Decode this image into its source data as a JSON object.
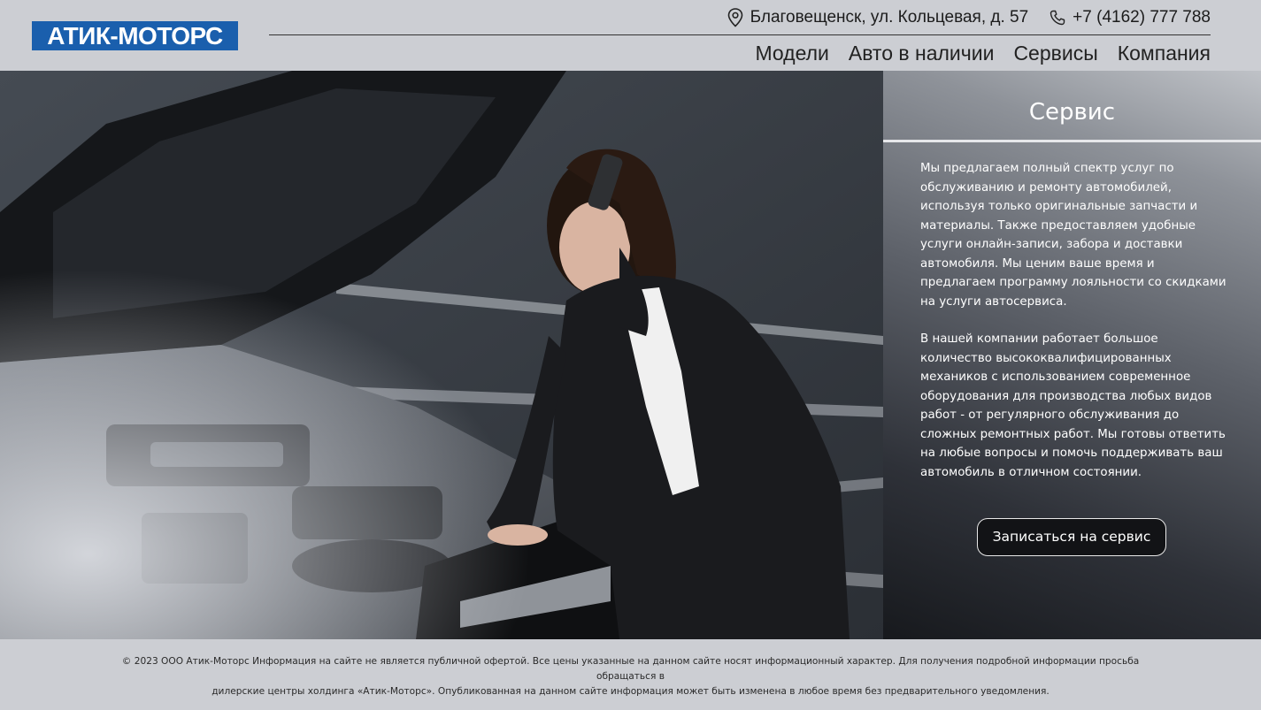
{
  "header": {
    "logo_text": "АТИК-МОТОРС",
    "address": "Благовещенск, ул. Кольцевая, д. 57",
    "phone": "+7 (4162) 777 788",
    "nav": [
      {
        "label": "Модели"
      },
      {
        "label": "Авто в наличии"
      },
      {
        "label": "Сервисы"
      },
      {
        "label": "Компания"
      }
    ]
  },
  "hero": {
    "image_alt": "Woman on phone looking under an open car hood",
    "panel": {
      "title": "Сервис",
      "paragraphs": [
        "Мы предлагаем полный спектр услуг по обслуживанию и ремонту автомобилей, используя только оригинальные запчасти и материалы. Также предоставляем удобные услуги онлайн-записи, забора и доставки автомобиля. Мы ценим ваше время и предлагаем программу лояльности со скидками на услуги автосервиса.",
        "В нашей компании работает большое количество высококвалифицированных механиков с использованием современное оборудования для производства любых видов работ - от регулярного обслуживания до сложных ремонтных работ. Мы готовы ответить на любые вопросы и помочь поддерживать ваш автомобиль в отличном состоянии."
      ],
      "cta_label": "Записаться на сервис"
    }
  },
  "footer": {
    "line1": "© 2023 ООО Атик-Моторс Информация на сайте не является публичной офертой. Все цены указанные на данном сайте носят информационный характер. Для получения подробной информации просьба обращаться в",
    "line2": "дилерские центры холдинга «Атик-Моторс». Опубликованная на данном сайте информация может быть изменена в любое время без предварительного уведомления."
  },
  "colors": {
    "header_bg": "#ccced3",
    "logo_bg": "#1a5fad",
    "cta_bg": "#121316"
  },
  "icons": [
    "location-pin-icon",
    "phone-icon"
  ]
}
